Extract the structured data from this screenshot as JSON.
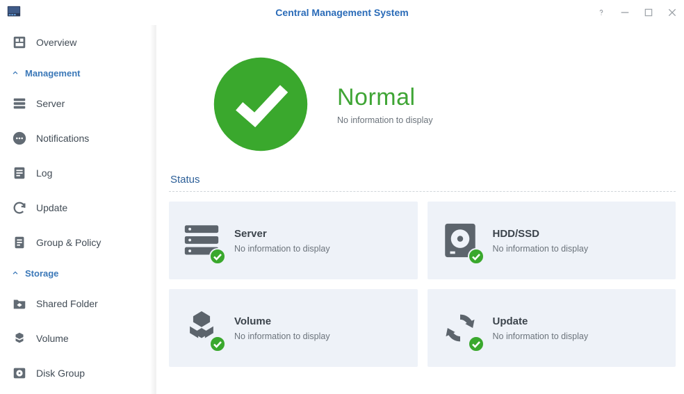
{
  "window": {
    "title": "Central Management System"
  },
  "sidebar": {
    "items": [
      {
        "label": "Overview",
        "icon": "overview"
      },
      {
        "section": "Management"
      },
      {
        "label": "Server",
        "icon": "server"
      },
      {
        "label": "Notifications",
        "icon": "notifications"
      },
      {
        "label": "Log",
        "icon": "log"
      },
      {
        "label": "Update",
        "icon": "update"
      },
      {
        "label": "Group & Policy",
        "icon": "policy"
      },
      {
        "section": "Storage"
      },
      {
        "label": "Shared Folder",
        "icon": "shared-folder"
      },
      {
        "label": "Volume",
        "icon": "volume"
      },
      {
        "label": "Disk Group",
        "icon": "disk-group"
      }
    ],
    "sections": {
      "management": "Management",
      "storage": "Storage"
    },
    "labels": {
      "overview": "Overview",
      "server": "Server",
      "notifications": "Notifications",
      "log": "Log",
      "update": "Update",
      "group_policy": "Group & Policy",
      "shared_folder": "Shared Folder",
      "volume": "Volume",
      "disk_group": "Disk Group"
    }
  },
  "hero": {
    "status": "Normal",
    "subtext": "No information to display"
  },
  "status_section": {
    "heading": "Status",
    "cards": {
      "server": {
        "title": "Server",
        "subtext": "No information to display"
      },
      "hddssd": {
        "title": "HDD/SSD",
        "subtext": "No information to display"
      },
      "volume": {
        "title": "Volume",
        "subtext": "No information to display"
      },
      "update": {
        "title": "Update",
        "subtext": "No information to display"
      }
    }
  },
  "colors": {
    "accent_blue": "#2a6bb8",
    "status_green": "#3aa82d",
    "card_bg": "#eef2f8",
    "icon_gray": "#5c646c"
  }
}
